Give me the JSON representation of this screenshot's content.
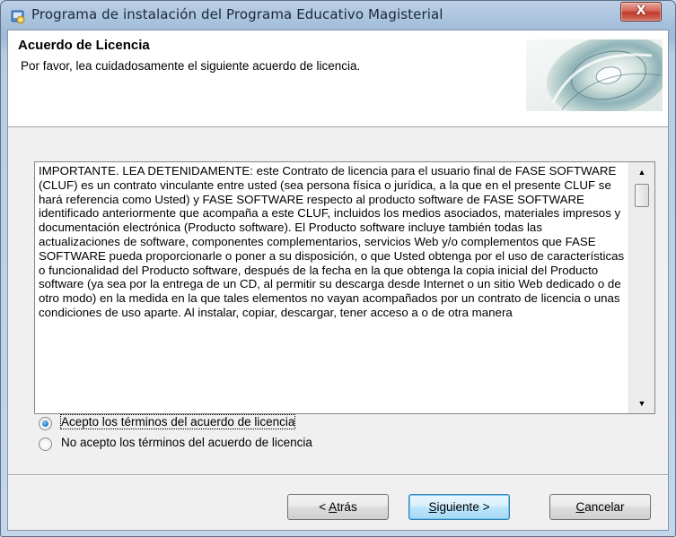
{
  "window": {
    "title": "Programa de instalación del Programa Educativo Magisterial",
    "close_label": "X"
  },
  "header": {
    "title": "Acuerdo de Licencia",
    "subtitle": "Por favor, lea cuidadosamente el siguiente acuerdo de licencia."
  },
  "license": {
    "text": "IMPORTANTE. LEA DETENIDAMENTE: este Contrato de licencia para el usuario final de FASE SOFTWARE (CLUF) es un contrato vinculante entre usted (sea persona física o jurídica, a la que en el presente CLUF se hará referencia como Usted) y FASE SOFTWARE respecto al producto software de FASE SOFTWARE identificado anteriormente que acompaña a este CLUF, incluidos los medios asociados, materiales impresos y documentación electrónica (Producto software).  El Producto software incluye también todas las actualizaciones de software, componentes complementarios, servicios Web y/o complementos que FASE SOFTWARE pueda proporcionarle o poner a su disposición, o que Usted obtenga por el uso de características o funcionalidad del Producto software, después de la fecha en la que obtenga la copia inicial del Producto software (ya sea por la entrega de un CD, al permitir su descarga desde Internet o un sitio Web dedicado o de otro modo) en la medida en la que tales elementos no vayan acompañados por un contrato de licencia o unas condiciones de uso aparte.  Al instalar, copiar, descargar, tener acceso a o de otra manera"
  },
  "options": {
    "accept_label": "Acepto los términos del acuerdo de licencia",
    "decline_label": "No acepto los términos del acuerdo de licencia",
    "selected": "accept"
  },
  "buttons": {
    "back": {
      "before": "< ",
      "mnemonic": "A",
      "after": "trás"
    },
    "next": {
      "before": "",
      "mnemonic": "S",
      "after": "iguiente >"
    },
    "cancel": {
      "before": "",
      "mnemonic": "C",
      "after": "ancelar"
    }
  },
  "icons": {
    "app": "installer-icon",
    "header_image": "cd-disc-image"
  }
}
